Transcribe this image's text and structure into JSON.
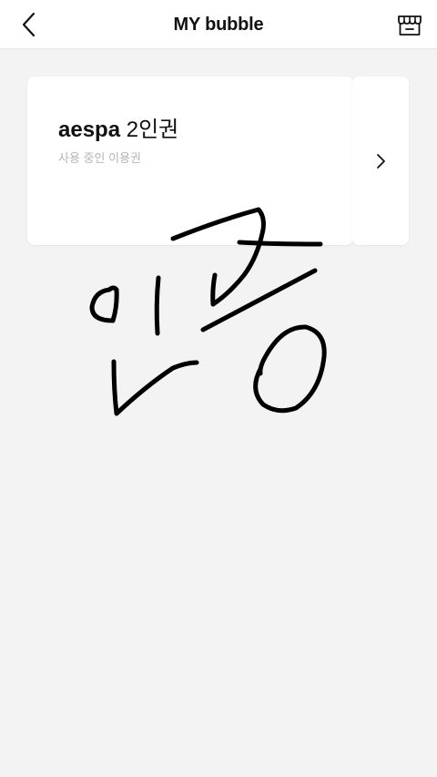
{
  "header": {
    "title": "MY bubble",
    "back_icon": "chevron-left-icon",
    "store_icon": "store-icon"
  },
  "pass_card": {
    "brand": "aespa",
    "pass_name": "2인권",
    "status": "사용 중인 이용권"
  },
  "next_card": {
    "icon": "chevron-right-icon"
  },
  "handwriting": {
    "text": "인증"
  },
  "colors": {
    "background": "#f3f3f3",
    "card": "#ffffff",
    "subtitle_text": "#b5b5b5",
    "ink": "#000000"
  }
}
